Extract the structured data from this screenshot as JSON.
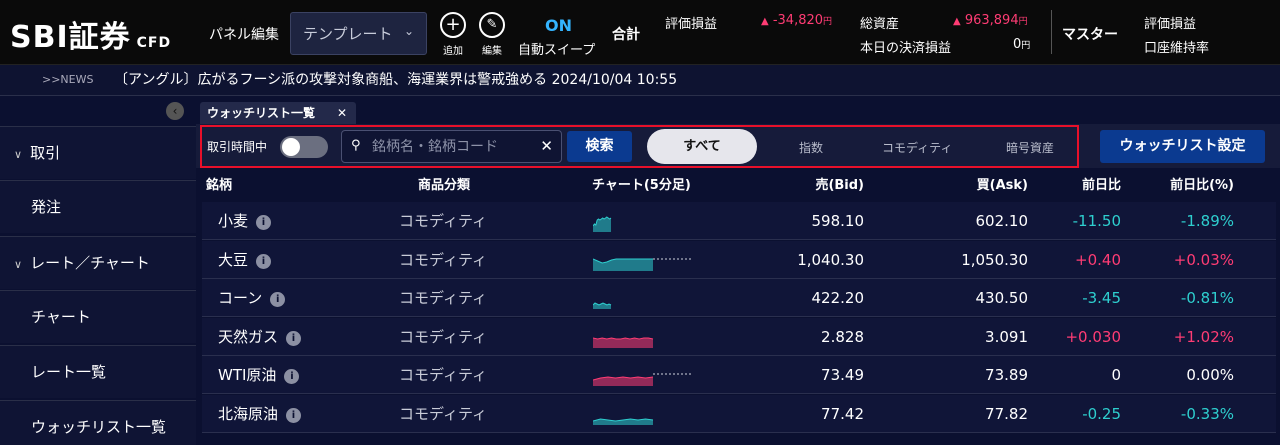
{
  "header": {
    "logo": "SBI証券",
    "logo_sub": "CFD",
    "panel_edit": "パネル編集",
    "template_select": "テンプレート",
    "add_label": "追加",
    "edit_label": "編集",
    "auto_sweep_state": "ON",
    "auto_sweep_label": "自動スイープ",
    "total_label": "合計",
    "pnl_label": "評価損益",
    "pnl_value": "-34,820",
    "yen": "円",
    "assets_label": "総資産",
    "assets_value": "963,894",
    "settle_label": "本日の決済損益",
    "settle_value": "0",
    "master_label": "マスター",
    "master_pnl_label": "評価損益",
    "margin_label": "口座維持率",
    "up_arrow": "▲"
  },
  "news": {
    "tag": ">>NEWS",
    "text": "〔アングル〕広がるフーシ派の攻撃対象商船、海運業界は警戒強める  2024/10/04 10:55"
  },
  "sidebar": {
    "items": [
      {
        "label": "取引",
        "group": true
      },
      {
        "label": "発注",
        "group": false
      },
      {
        "label": "レート／チャート",
        "group": true
      },
      {
        "label": "チャート",
        "group": false
      },
      {
        "label": "レート一覧",
        "group": false
      },
      {
        "label": "ウォッチリスト一覧",
        "group": false
      }
    ]
  },
  "main": {
    "tab_label": "ウォッチリスト一覧",
    "trading_hours_label": "取引時間中",
    "search_placeholder": "銘柄名・銘柄コード",
    "search_button": "検索",
    "filters": [
      "すべて",
      "指数",
      "コモディティ",
      "暗号資産"
    ],
    "watchlist_settings": "ウォッチリスト設定"
  },
  "table": {
    "columns": [
      "銘柄",
      "商品分類",
      "チャート(5分足)",
      "売(Bid)",
      "買(Ask)",
      "前日比",
      "前日比(%)"
    ],
    "rows": [
      {
        "name": "小麦",
        "category": "コモディティ",
        "bid": "598.10",
        "ask": "602.10",
        "change": "-11.50",
        "pct": "-1.89%",
        "dir": "down",
        "spark": [
          6,
          8,
          7,
          12,
          13,
          12,
          13,
          14,
          13,
          14,
          15,
          14,
          13,
          14
        ],
        "spark_color": "#2ecfcf"
      },
      {
        "name": "大豆",
        "category": "コモディティ",
        "bid": "1,040.30",
        "ask": "1,050.30",
        "change": "+0.40",
        "pct": "+0.03%",
        "dir": "up",
        "spark": [
          12,
          10,
          8,
          9,
          11,
          12,
          12,
          12,
          12,
          12,
          12,
          12,
          12,
          12
        ],
        "spark_color": "#2ecfcf"
      },
      {
        "name": "コーン",
        "category": "コモディティ",
        "bid": "422.20",
        "ask": "430.50",
        "change": "-3.45",
        "pct": "-0.81%",
        "dir": "down",
        "spark": [
          4,
          6,
          5,
          4,
          5,
          6,
          5,
          4,
          5,
          4
        ],
        "spark_color": "#2ecfcf"
      },
      {
        "name": "天然ガス",
        "category": "コモディティ",
        "bid": "2.828",
        "ask": "3.091",
        "change": "+0.030",
        "pct": "+1.02%",
        "dir": "up",
        "spark": [
          10,
          9,
          10,
          9,
          10,
          9,
          9,
          10,
          9,
          10,
          9,
          10,
          10,
          9
        ],
        "spark_color": "#ff3c74"
      },
      {
        "name": "WTI原油",
        "category": "コモディティ",
        "bid": "73.49",
        "ask": "73.89",
        "change": "0",
        "pct": "0.00%",
        "dir": "flat",
        "spark": [
          6,
          8,
          9,
          8,
          9,
          8,
          9,
          8,
          9
        ],
        "spark_color": "#ff3c74"
      },
      {
        "name": "北海原油",
        "category": "コモディティ",
        "bid": "77.42",
        "ask": "77.82",
        "change": "-0.25",
        "pct": "-0.33%",
        "dir": "down",
        "spark": [
          4,
          6,
          5,
          4,
          5,
          6,
          5,
          6,
          5
        ],
        "spark_color": "#2ecfcf"
      }
    ]
  }
}
